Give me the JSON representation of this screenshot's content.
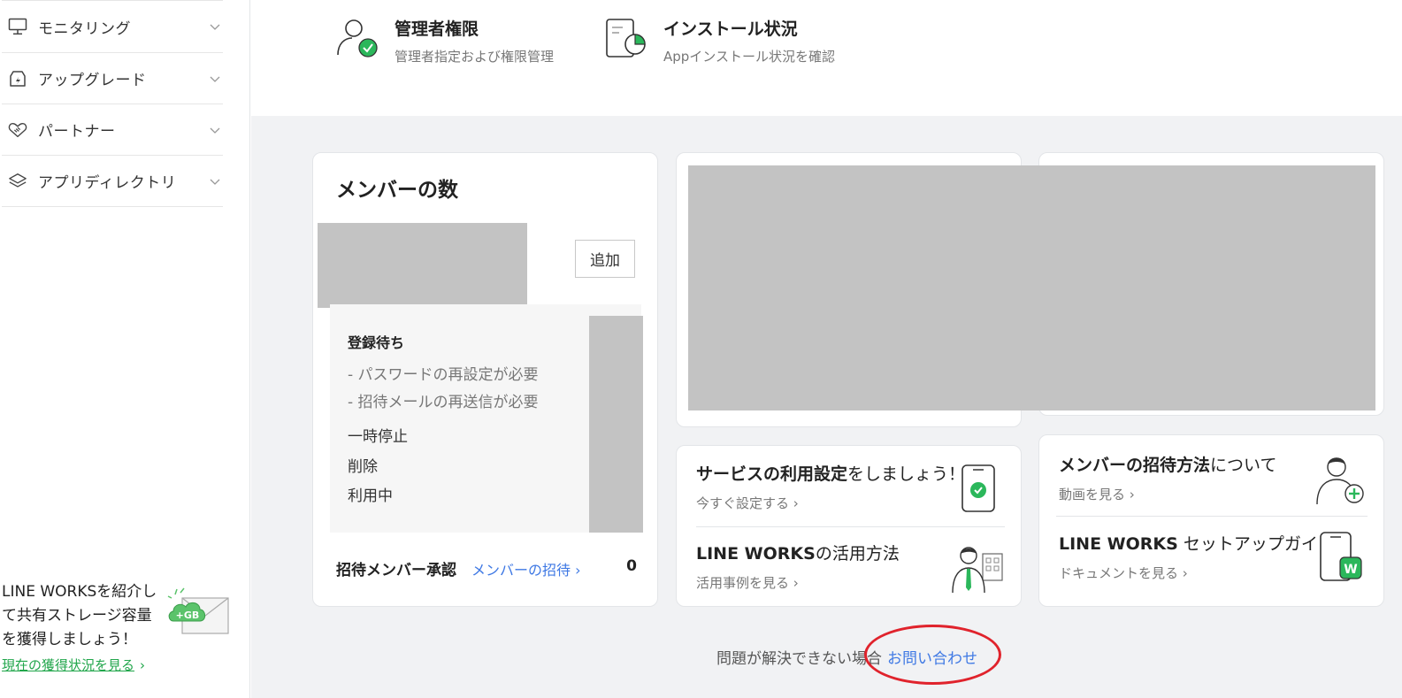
{
  "sidebar": {
    "items": [
      {
        "label": "モニタリング"
      },
      {
        "label": "アップグレード"
      },
      {
        "label": "パートナー"
      },
      {
        "label": "アプリディレクトリ"
      }
    ],
    "promo": {
      "text": "LINE WORKSを紹介して共有ストレージ容量を獲得しましょう！",
      "link": "現在の獲得状況を見る",
      "badge": "+GB"
    }
  },
  "tools": [
    {
      "title": "管理者権限",
      "desc": "管理者指定および権限管理"
    },
    {
      "title": "インストール状況",
      "desc": "Appインストール状況を確認"
    }
  ],
  "members": {
    "title": "メンバーの数",
    "add_label": "追加",
    "pending_title": "登録待ち",
    "pending_lines": [
      "- パスワードの再設定が必要",
      "- 招待メールの再送信が必要"
    ],
    "statuses": [
      "一時停止",
      "削除",
      "利用中"
    ],
    "invite_label": "招待メンバー承認",
    "invite_link": "メンバーの招待",
    "invite_count": "0"
  },
  "promos": [
    {
      "title_bold": "サービスの利用設定",
      "title_rest": "をしましょう！",
      "sub": "今すぐ設定する"
    },
    {
      "title_bold": "LINE WORKS",
      "title_rest": "の活用方法",
      "sub": "活用事例を見る"
    },
    {
      "title_bold": "メンバーの招待方法",
      "title_rest": "について",
      "sub": "動画を見る"
    },
    {
      "title_bold": "LINE WORKS",
      "title_rest": " セットアップガイド",
      "sub": "ドキュメントを見る"
    }
  ],
  "footer": {
    "text": "問題が解決できない場合",
    "link": "お問い合わせ"
  },
  "colors": {
    "accent_green": "#21a64b",
    "link_blue": "#3f79e4",
    "annotation_red": "#e0232c",
    "masked_gray": "#c3c3c3"
  }
}
